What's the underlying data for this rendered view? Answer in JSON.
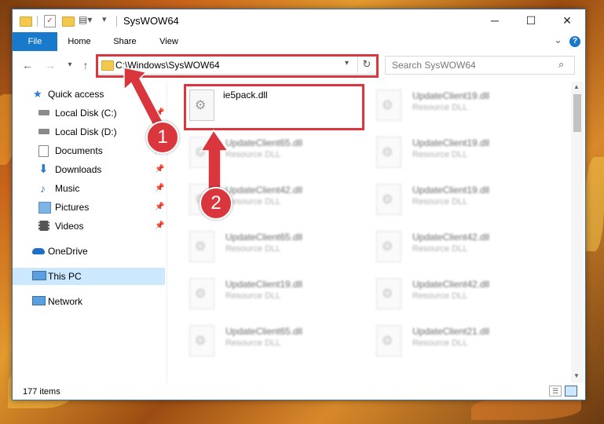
{
  "window": {
    "title": "SysWOW64",
    "controls": {
      "minimize": "─",
      "maximize": "☐",
      "close": "✕"
    }
  },
  "ribbon": {
    "tabs": [
      "File",
      "Home",
      "Share",
      "View"
    ],
    "help": "?",
    "expand": "⌄"
  },
  "address_bar": {
    "path": "C:\\Windows\\SysWOW64",
    "search_placeholder": "Search SysWOW64"
  },
  "sidebar": {
    "items": [
      {
        "label": "Quick access",
        "icon": "star-icon",
        "pinned": false
      },
      {
        "label": "Local Disk (C:)",
        "icon": "drive-icon",
        "pinned": true
      },
      {
        "label": "Local Disk (D:)",
        "icon": "drive-icon",
        "pinned": false
      },
      {
        "label": "Documents",
        "icon": "documents-icon",
        "pinned": true
      },
      {
        "label": "Downloads",
        "icon": "download-icon",
        "pinned": true
      },
      {
        "label": "Music",
        "icon": "music-icon",
        "pinned": true
      },
      {
        "label": "Pictures",
        "icon": "pictures-icon",
        "pinned": true
      },
      {
        "label": "Videos",
        "icon": "videos-icon",
        "pinned": true
      },
      {
        "label": "OneDrive",
        "icon": "cloud-icon",
        "pinned": false
      },
      {
        "label": "This PC",
        "icon": "computer-icon",
        "pinned": false,
        "selected": true
      },
      {
        "label": "Network",
        "icon": "network-icon",
        "pinned": false
      }
    ]
  },
  "files": {
    "highlighted": {
      "name": "ie5pack.dll"
    },
    "col1": [
      {
        "name": "UpdateClient65.dll",
        "type": "Resource DLL"
      },
      {
        "name": "UpdateClient42.dll",
        "type": "Resource DLL"
      },
      {
        "name": "UpdateClient65.dll",
        "type": "Resource DLL"
      },
      {
        "name": "UpdateClient19.dll",
        "type": "Resource DLL"
      },
      {
        "name": "UpdateClient65.dll",
        "type": "Resource DLL"
      }
    ],
    "col2": [
      {
        "name": "UpdateClient19.dll",
        "type": "Resource DLL"
      },
      {
        "name": "UpdateClient19.dll",
        "type": "Resource DLL"
      },
      {
        "name": "UpdateClient19.dll",
        "type": "Resource DLL"
      },
      {
        "name": "UpdateClient42.dll",
        "type": "Resource DLL"
      },
      {
        "name": "UpdateClient42.dll",
        "type": "Resource DLL"
      },
      {
        "name": "UpdateClient21.dll",
        "type": "Resource DLL"
      }
    ]
  },
  "status": {
    "item_count": "177 items"
  },
  "annotations": {
    "step1": "1",
    "step2": "2",
    "color": "#d9363e"
  }
}
